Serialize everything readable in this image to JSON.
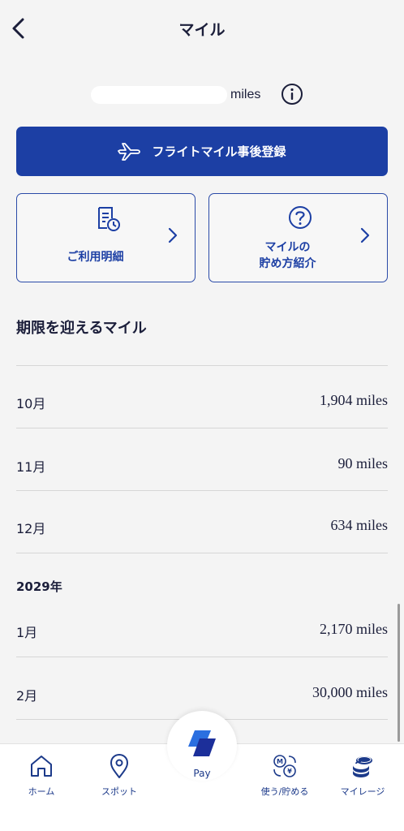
{
  "header": {
    "title": "マイル"
  },
  "balance": {
    "unit": "miles"
  },
  "actions": {
    "flight_register": "フライトマイル事後登録",
    "usage_history": "ご利用明細",
    "how_to_earn_line1": "マイルの",
    "how_to_earn_line2": "貯め方紹介"
  },
  "expiring": {
    "title": "期限を迎えるマイル",
    "rows_2028": [
      {
        "month": "10月",
        "miles": "1,904 miles"
      },
      {
        "month": "11月",
        "miles": "90 miles"
      },
      {
        "month": "12月",
        "miles": "634 miles"
      }
    ],
    "year": "2029年",
    "rows_2029": [
      {
        "month": "1月",
        "miles": "2,170 miles"
      },
      {
        "month": "2月",
        "miles": "30,000 miles"
      }
    ]
  },
  "tabbar": {
    "home": "ホーム",
    "spot": "スポット",
    "pay": "Pay",
    "use_earn": "使う/貯める",
    "mileage": "マイレージ"
  },
  "colors": {
    "brand_blue": "#1c3fa4",
    "text_dark": "#1b1e3a",
    "background": "#f4f4f4"
  }
}
